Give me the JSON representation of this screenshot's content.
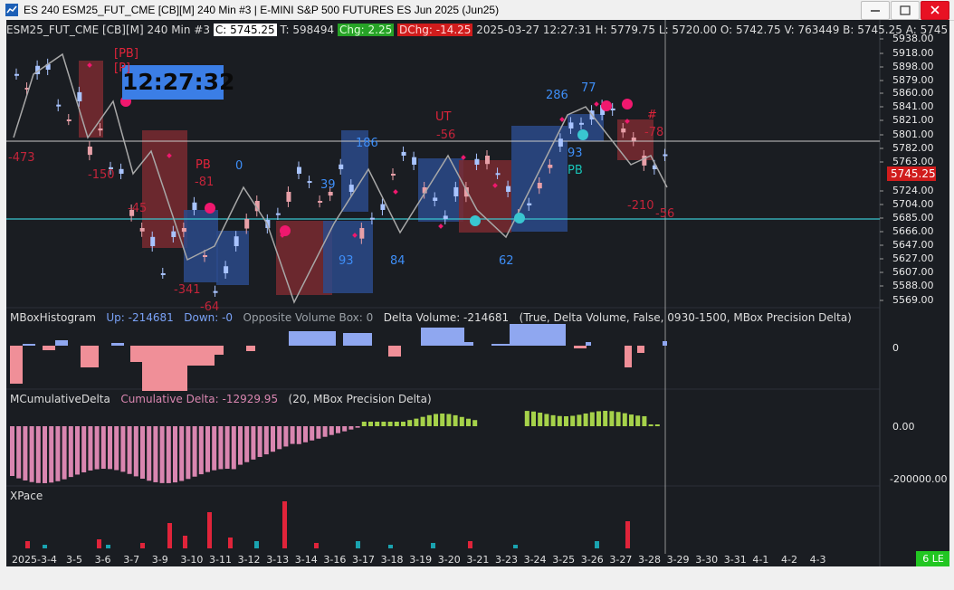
{
  "window": {
    "title": "ES 240 ESM25_FUT_CME [CB][M]  240 Min  #3 | E-MINI S&P 500 FUTURES ES Jun 2025 (Jun25)",
    "minimize": "—",
    "maximize": "☐",
    "close": "✕"
  },
  "info_bar": {
    "symbol": "ESM25_FUT_CME [CB][M]  240 Min  #3",
    "close": "C: 5745.25",
    "trades": "T: 598494",
    "chg": "Chg: 2.25",
    "dchg": "DChg: -14.25",
    "timestamp": "2025-03-27 12:27:31",
    "high": "H: 5779.75",
    "low": "L: 5720.00",
    "open": "O: 5742.75",
    "volume": "V: 763449",
    "bid": "B: 5745.25",
    "ask": "A: 5745"
  },
  "clock": "12:27:32",
  "price_axis": [
    "5938.00",
    "5918.00",
    "5898.00",
    "5879.00",
    "5860.00",
    "5841.00",
    "5821.00",
    "5801.00",
    "5782.00",
    "5763.00",
    "5724.00",
    "5704.00",
    "5685.00",
    "5666.00",
    "5647.00",
    "5627.00",
    "5607.00",
    "5588.00",
    "5569.00"
  ],
  "current_price": "5745.25",
  "panes": {
    "histogram": {
      "label": "MBoxHistogram",
      "up": "Up: -214681",
      "down": "Down: -0",
      "opposite": "Opposite Volume Box: 0",
      "delta": "Delta Volume: -214681",
      "params": "(True, Delta Volume, False, 0930-1500, MBox Precision Delta)",
      "axis": "0"
    },
    "cumulative": {
      "label": "MCumulativeDelta",
      "value": "Cumulative Delta: -12929.95",
      "params": "(20, MBox Precision Delta)",
      "axis_zero": "0.00",
      "axis_low": "-200000.00"
    },
    "xpace": {
      "label": "XPace"
    }
  },
  "annotations": [
    {
      "text": "[PB]",
      "color": "#e0243a"
    },
    {
      "text": "[P]",
      "color": "#e0243a"
    },
    {
      "text": "-473",
      "color": "#c4243a"
    },
    {
      "text": "-150",
      "color": "#c4243a"
    },
    {
      "text": "-45",
      "color": "#c4243a"
    },
    {
      "text": "PB",
      "color": "#e0243a"
    },
    {
      "text": "-81",
      "color": "#c4243a"
    },
    {
      "text": "0",
      "color": "#3e8ef7"
    },
    {
      "text": "-341",
      "color": "#c4243a"
    },
    {
      "text": "-64",
      "color": "#c4243a"
    },
    {
      "text": "39",
      "color": "#3e8ef7"
    },
    {
      "text": "186",
      "color": "#3e8ef7"
    },
    {
      "text": "93",
      "color": "#3e8ef7"
    },
    {
      "text": "84",
      "color": "#3e8ef7"
    },
    {
      "text": "UT",
      "color": "#e0243a"
    },
    {
      "text": "-56",
      "color": "#c4243a"
    },
    {
      "text": "62",
      "color": "#3e8ef7"
    },
    {
      "text": "286",
      "color": "#3e8ef7"
    },
    {
      "text": "77",
      "color": "#3e8ef7"
    },
    {
      "text": "93",
      "color": "#3e8ef7"
    },
    {
      "text": "PB",
      "color": "#18c2b6"
    },
    {
      "text": "#",
      "color": "#e0243a"
    },
    {
      "text": "-78",
      "color": "#c4243a"
    },
    {
      "text": "-210",
      "color": "#c4243a"
    },
    {
      "text": "-56",
      "color": "#c4243a"
    }
  ],
  "dates": [
    "2025-3-4",
    "3-5",
    "3-6",
    "3-7",
    "3-9",
    "3-10",
    "3-11",
    "3-12",
    "3-13",
    "3-14",
    "3-16",
    "3-17",
    "3-18",
    "3-19",
    "3-20",
    "3-21",
    "3-23",
    "3-24",
    "3-25",
    "3-26",
    "3-27",
    "3-28",
    "3-29",
    "3-30",
    "3-31",
    "4-1",
    "4-2",
    "4-3"
  ],
  "badge": "6 LE",
  "colors": {
    "background": "#1a1d22",
    "up_candle": "#a9c4ff",
    "down_candle": "#e8a0a8",
    "up_box": "#2b4a8a",
    "down_box": "#7a2a30",
    "hist_pos": "#8fa7f0",
    "hist_neg": "#f08f98",
    "cum_pos": "#a6d24a",
    "cum_neg": "#d986b0",
    "xpace_red": "#e0243a",
    "xpace_teal": "#1aa3b0",
    "cyan_line": "#39c6d0"
  }
}
